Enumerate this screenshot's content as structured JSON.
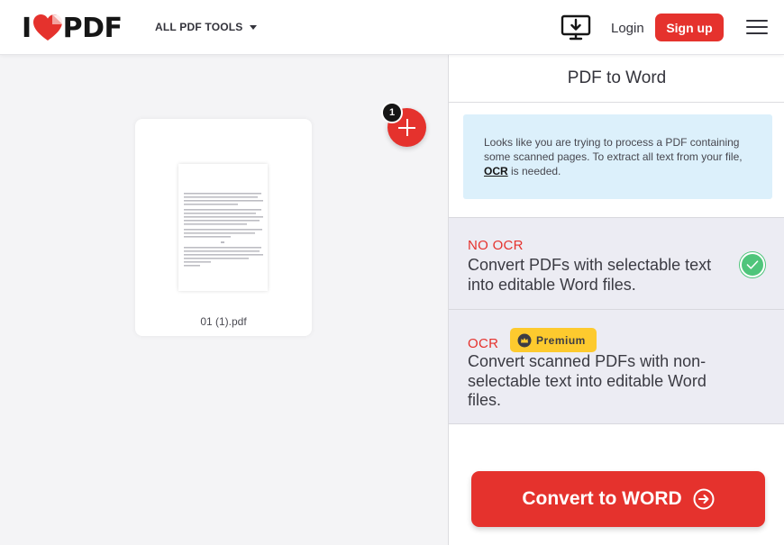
{
  "header": {
    "logo_text_left": "I",
    "logo_text_right": "PDF",
    "tools_label": "ALL PDF TOOLS",
    "login_label": "Login",
    "signup_label": "Sign up",
    "icons": [
      "heart-logo-icon",
      "chevron-down-icon",
      "desktop-download-icon",
      "hamburger-menu-icon"
    ]
  },
  "workspace": {
    "file_name": "01 (1).pdf",
    "file_count": "1",
    "icons": [
      "plus-icon"
    ]
  },
  "sidebar": {
    "title": "PDF to Word",
    "info": {
      "text_before": "Looks like you are trying to process a PDF containing some scanned pages. To extract all text from your file, ",
      "link": "OCR",
      "text_after": " is needed."
    },
    "options": [
      {
        "title": "NO OCR",
        "description": "Convert PDFs with selectable text into editable Word files.",
        "selected": true
      },
      {
        "title": "OCR",
        "badge": "Premium",
        "description": "Convert scanned PDFs with non-selectable text into editable Word files.",
        "selected": false
      }
    ],
    "convert_label": "Convert to WORD",
    "colors": {
      "brand_red": "#e5322d",
      "check_green": "#4fc57b",
      "premium_yellow": "#fdca2e",
      "info_blue": "#dcf0fb"
    }
  }
}
